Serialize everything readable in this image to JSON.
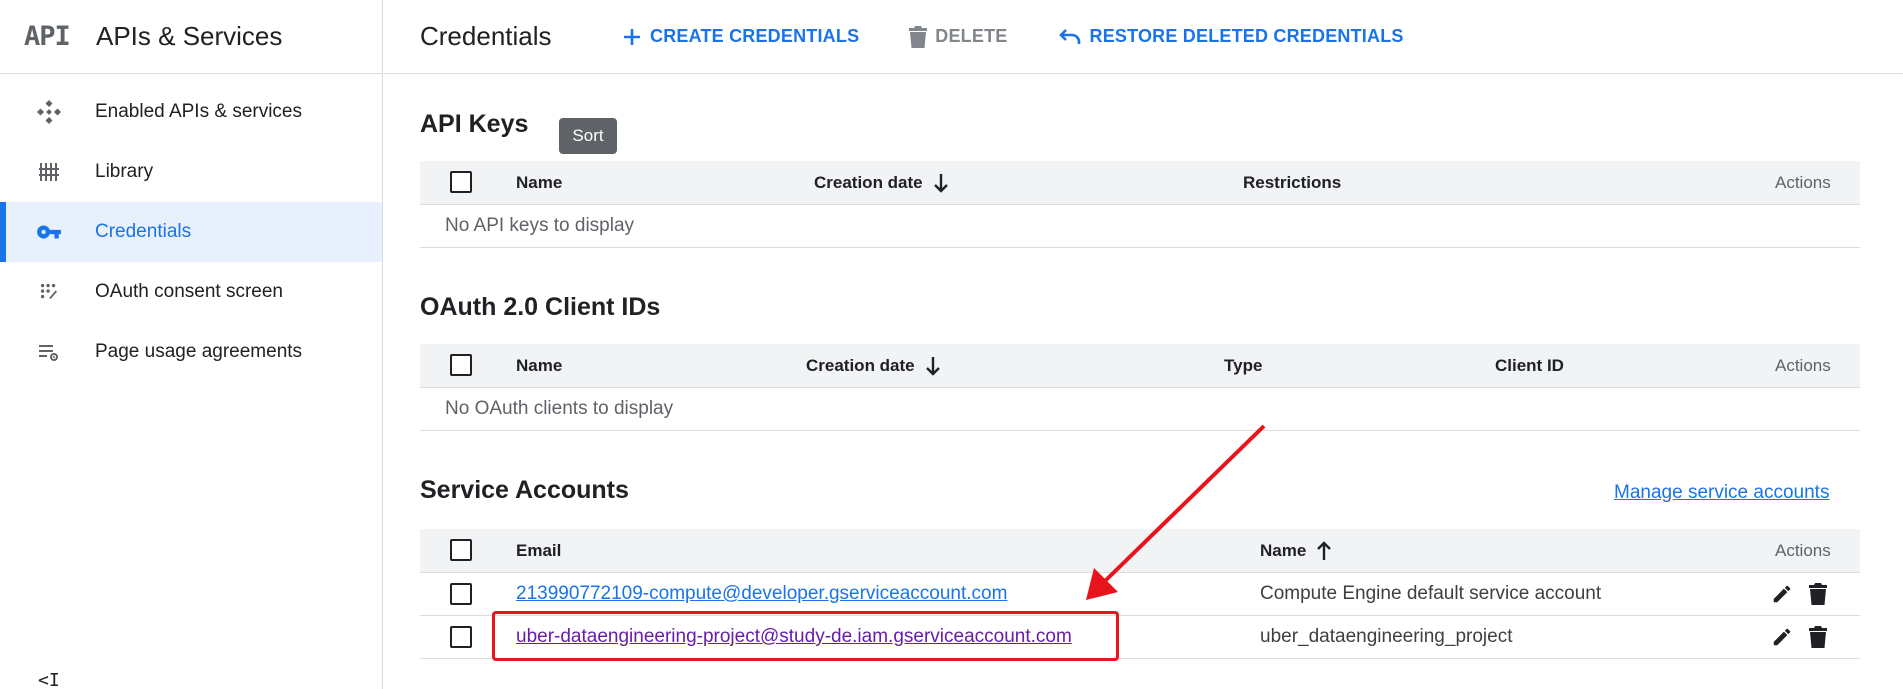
{
  "app": {
    "logo_text": "API",
    "title": "APIs & Services"
  },
  "sidebar": {
    "items": [
      {
        "label": "Enabled APIs & services",
        "icon": "enabled-apis-icon",
        "active": false
      },
      {
        "label": "Library",
        "icon": "library-icon",
        "active": false
      },
      {
        "label": "Credentials",
        "icon": "key-icon",
        "active": true
      },
      {
        "label": "OAuth consent screen",
        "icon": "oauth-consent-icon",
        "active": false
      },
      {
        "label": "Page usage agreements",
        "icon": "settings-list-icon",
        "active": false
      }
    ],
    "collapse_glyph": "<I"
  },
  "header": {
    "page_title": "Credentials",
    "create_label": "CREATE CREDENTIALS",
    "delete_label": "DELETE",
    "restore_label": "RESTORE DELETED CREDENTIALS"
  },
  "tooltip": {
    "text": "Sort"
  },
  "api_keys": {
    "title": "API Keys",
    "columns": [
      "Name",
      "Creation date",
      "Restrictions",
      "Actions"
    ],
    "sort_direction": "descending",
    "empty_text": "No API keys to display"
  },
  "oauth": {
    "title": "OAuth 2.0 Client IDs",
    "columns": [
      "Name",
      "Creation date",
      "Type",
      "Client ID",
      "Actions"
    ],
    "sort_direction": "descending",
    "empty_text": "No OAuth clients to display"
  },
  "service_accounts": {
    "title": "Service Accounts",
    "manage_link": "Manage service accounts",
    "columns": [
      "Email",
      "Name",
      "Actions"
    ],
    "sort_direction": "ascending",
    "rows": [
      {
        "email": "213990772109-compute@developer.gserviceaccount.com",
        "name": "Compute Engine default service account",
        "visited": false
      },
      {
        "email": "uber-dataengineering-project@study-de.iam.gserviceaccount.com",
        "name": "uber_dataengineering_project",
        "visited": true
      }
    ]
  },
  "annotation": {
    "highlight_color": "#e8141b"
  },
  "colors": {
    "accent": "#1a73e8",
    "active_bg": "#e8f0fe",
    "visited_link": "#681da8",
    "header_bg": "#f1f3f4"
  }
}
